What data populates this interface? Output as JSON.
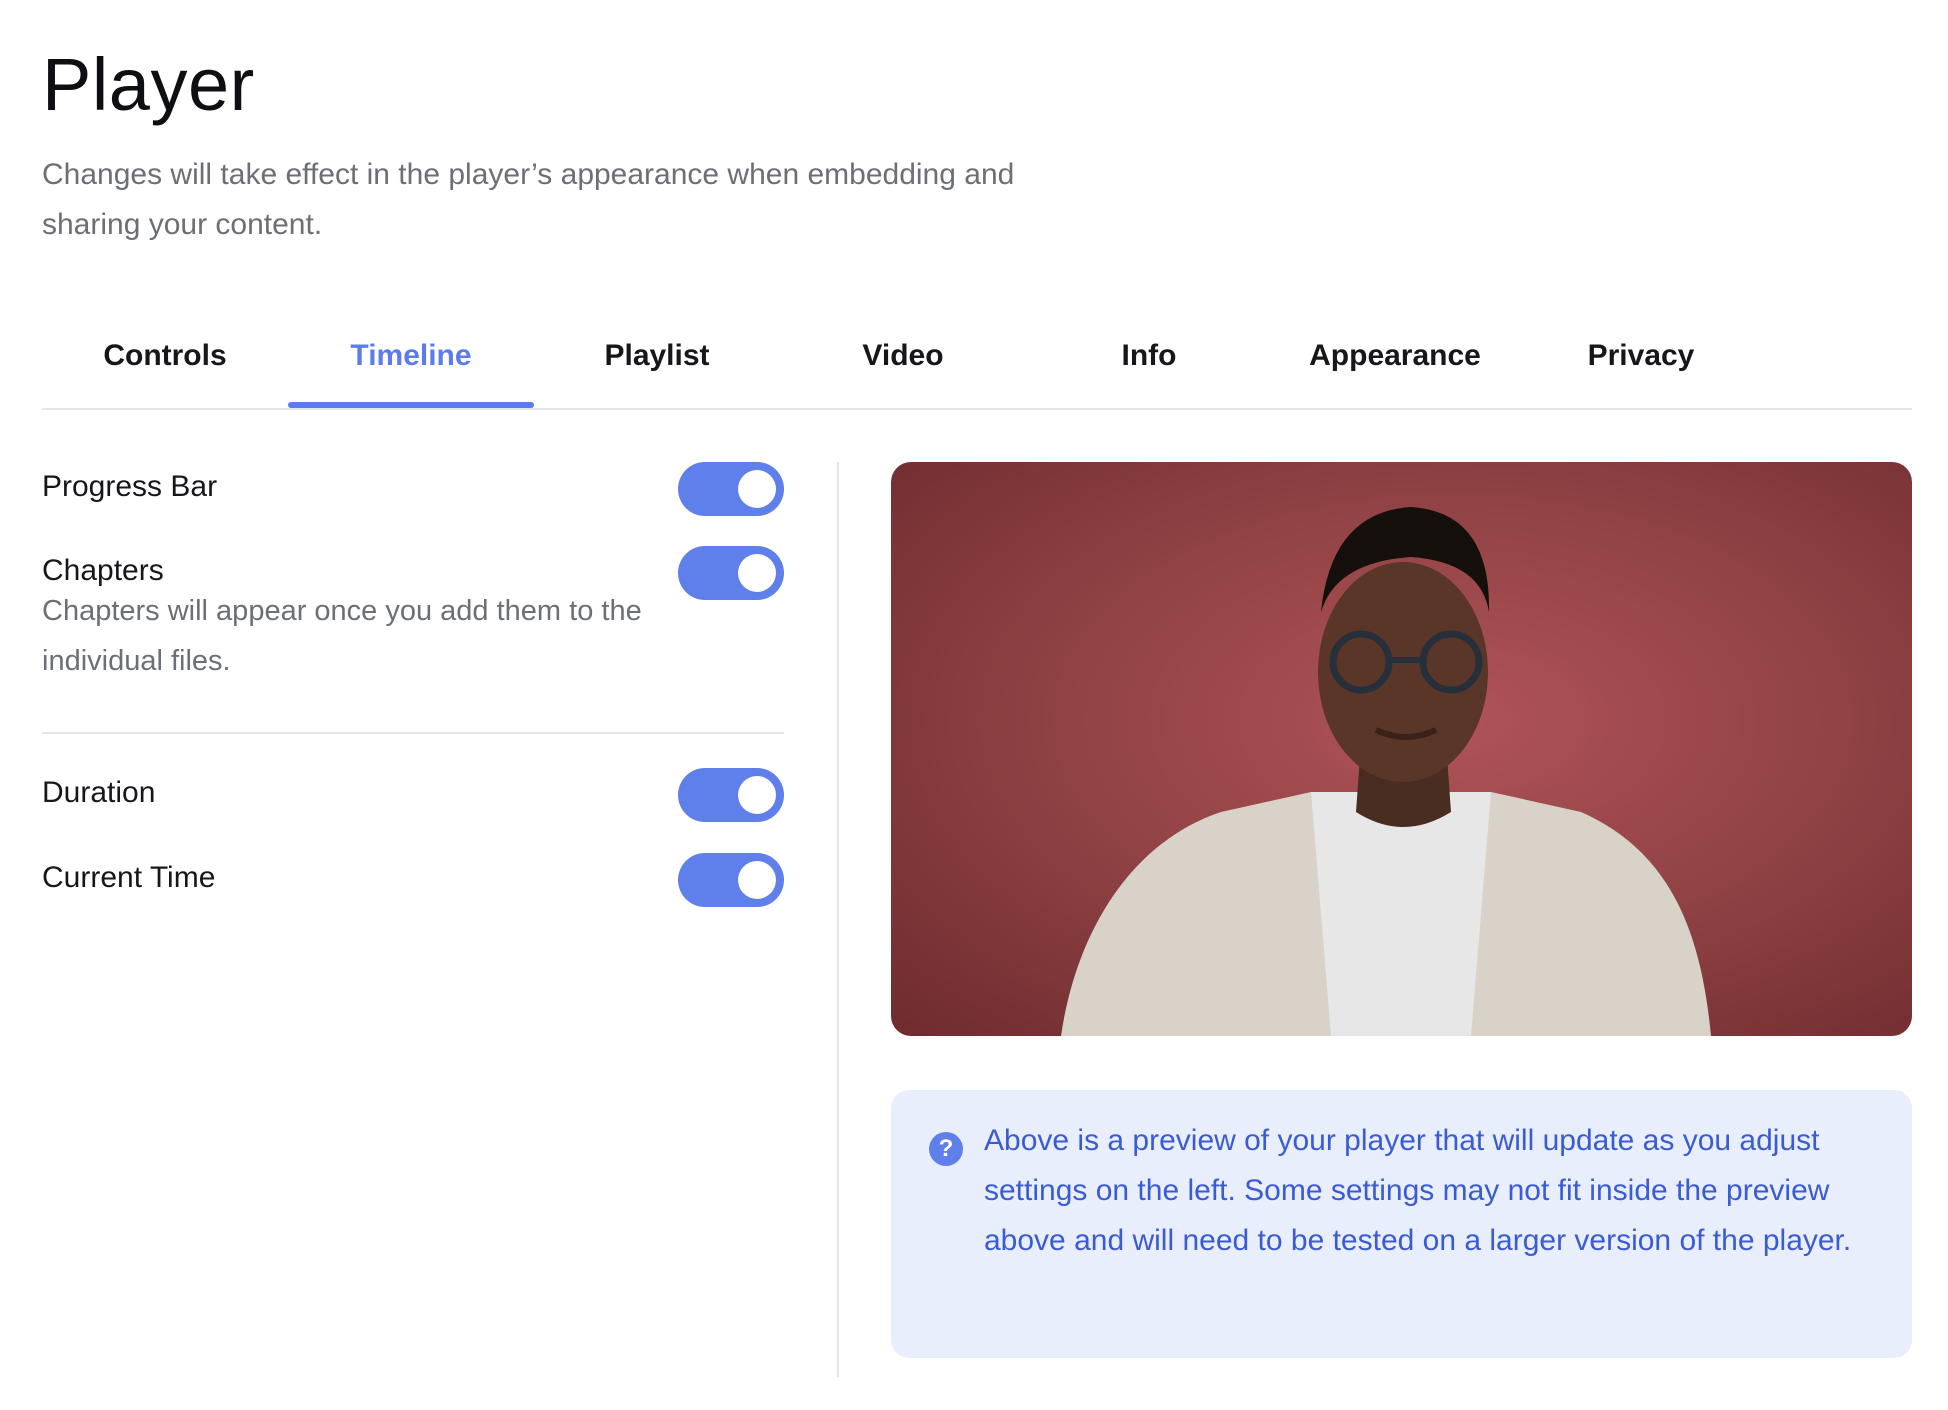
{
  "page": {
    "title": "Player",
    "subtitle": "Changes will take effect in the player’s appearance when embedding and sharing your content."
  },
  "tabs": [
    {
      "label": "Controls",
      "active": false
    },
    {
      "label": "Timeline",
      "active": true
    },
    {
      "label": "Playlist",
      "active": false
    },
    {
      "label": "Video",
      "active": false
    },
    {
      "label": "Info",
      "active": false
    },
    {
      "label": "Appearance",
      "active": false
    },
    {
      "label": "Privacy",
      "active": false
    }
  ],
  "settings": {
    "progress_bar": {
      "label": "Progress Bar",
      "enabled": true
    },
    "chapters": {
      "label": "Chapters",
      "description": "Chapters will appear once you add them to the individual files.",
      "enabled": true
    },
    "duration": {
      "label": "Duration",
      "enabled": true
    },
    "current_time": {
      "label": "Current Time",
      "enabled": true
    }
  },
  "info": {
    "icon": "question-circle-icon",
    "text": "Above is a preview of your player that will update as you adjust settings on the left. Some settings may not fit inside the preview above and will need to be tested on a larger version of the player."
  },
  "colors": {
    "accent": "#5c7ced",
    "toggle_on": "#5f7fea",
    "info_bg": "#e9eefc",
    "info_text": "#3a5bd4"
  }
}
